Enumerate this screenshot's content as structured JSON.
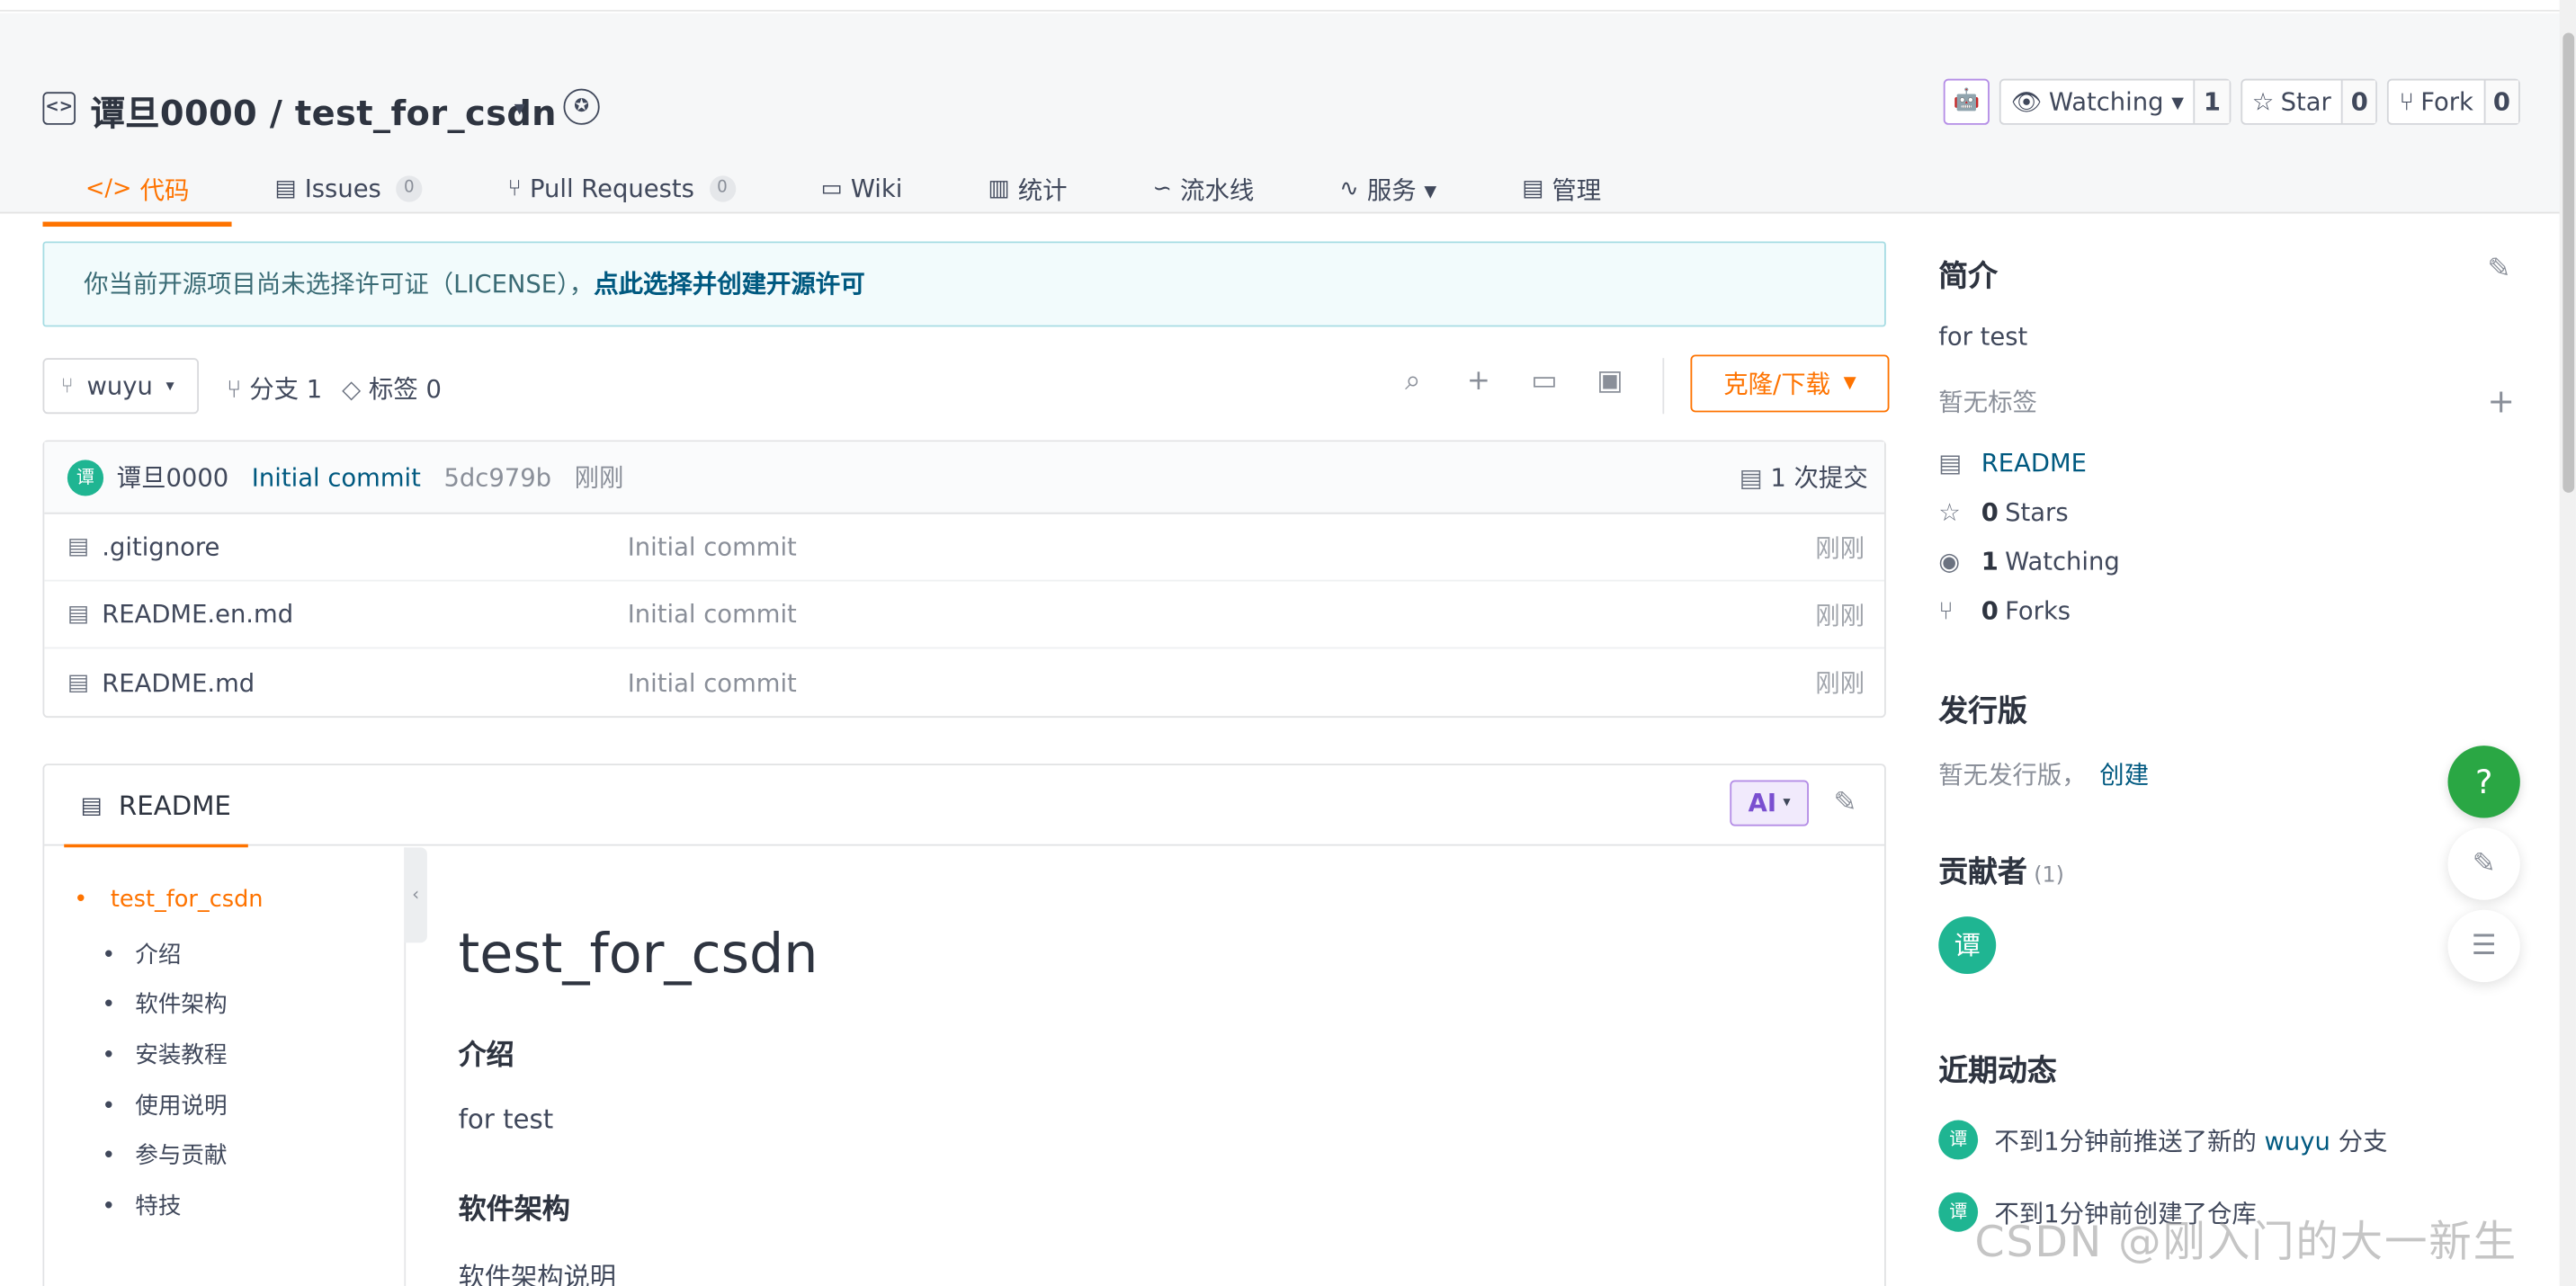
{
  "repo": {
    "title": "谭旦0000 / test_for_csdn",
    "icon": "code-brackets-icon",
    "caret": "▾",
    "badge_icon": "award-badge-icon"
  },
  "header_buttons": {
    "ai_icon": "🤖",
    "watching_label": "Watching ▾",
    "watching_count": "1",
    "star_label": "Star",
    "star_count": "0",
    "fork_label": "Fork",
    "fork_count": "0"
  },
  "tabs": [
    {
      "label": "代码",
      "icon": "</>"
    },
    {
      "label": "Issues",
      "icon": "▤",
      "count": "0"
    },
    {
      "label": "Pull Requests",
      "icon": "⑂",
      "count": "0"
    },
    {
      "label": "Wiki",
      "icon": "▭"
    },
    {
      "label": "统计",
      "icon": "▥"
    },
    {
      "label": "流水线",
      "icon": "∽"
    },
    {
      "label": "服务 ▾",
      "icon": "∿"
    },
    {
      "label": "管理",
      "icon": "▤"
    }
  ],
  "license": {
    "text": "你当前开源项目尚未选择许可证（LICENSE），",
    "link": "点此选择并创建开源许可"
  },
  "branch": {
    "name": "wuyu",
    "branches_label": "分支 1",
    "tags_label": "标签 0",
    "clone_label": "克隆/下载"
  },
  "commit": {
    "avatar": "谭",
    "author": "谭旦0000",
    "message": "Initial commit",
    "sha": "5dc979b",
    "time": "刚刚",
    "total": "1 次提交"
  },
  "files": [
    {
      "name": ".gitignore",
      "message": "Initial commit",
      "time": "刚刚"
    },
    {
      "name": "README.en.md",
      "message": "Initial commit",
      "time": "刚刚"
    },
    {
      "name": "README.md",
      "message": "Initial commit",
      "time": "刚刚"
    }
  ],
  "readme": {
    "tab_label": "README",
    "ai_label": "AI",
    "toc": [
      "test_for_csdn",
      "介绍",
      "软件架构",
      "安装教程",
      "使用说明",
      "参与贡献",
      "特技"
    ],
    "h1": "test_for_csdn",
    "h2_intro": "介绍",
    "p_intro": "for test",
    "h2_arch": "软件架构",
    "p_arch": "软件架构说明"
  },
  "sidebar": {
    "intro_title": "简介",
    "intro_text": "for test",
    "no_tags": "暂无标签",
    "readme_link": "README",
    "stars_count": "0",
    "stars_label": "Stars",
    "watching_count": "1",
    "watching_label": "Watching",
    "forks_count": "0",
    "forks_label": "Forks",
    "release_title": "发行版",
    "no_release": "暂无发行版，",
    "create_link": "创建",
    "contributors_title": "贡献者",
    "contributors_count": "(1)",
    "contributor_avatar": "谭",
    "activity_title": "近期动态",
    "activity": [
      {
        "avatar": "谭",
        "prefix": "不到1分钟前推送了新的",
        "link": "wuyu",
        "suffix": "分支"
      },
      {
        "avatar": "谭",
        "prefix": "不到1分钟前创建了仓库",
        "link": "",
        "suffix": ""
      }
    ]
  },
  "floating": {
    "help": "?"
  },
  "watermark": "CSDN @刚入门的大一新生",
  "colors": {
    "accent": "#fe7300",
    "link": "#005980",
    "avatar": "#1fb592",
    "help": "#2aa744"
  }
}
